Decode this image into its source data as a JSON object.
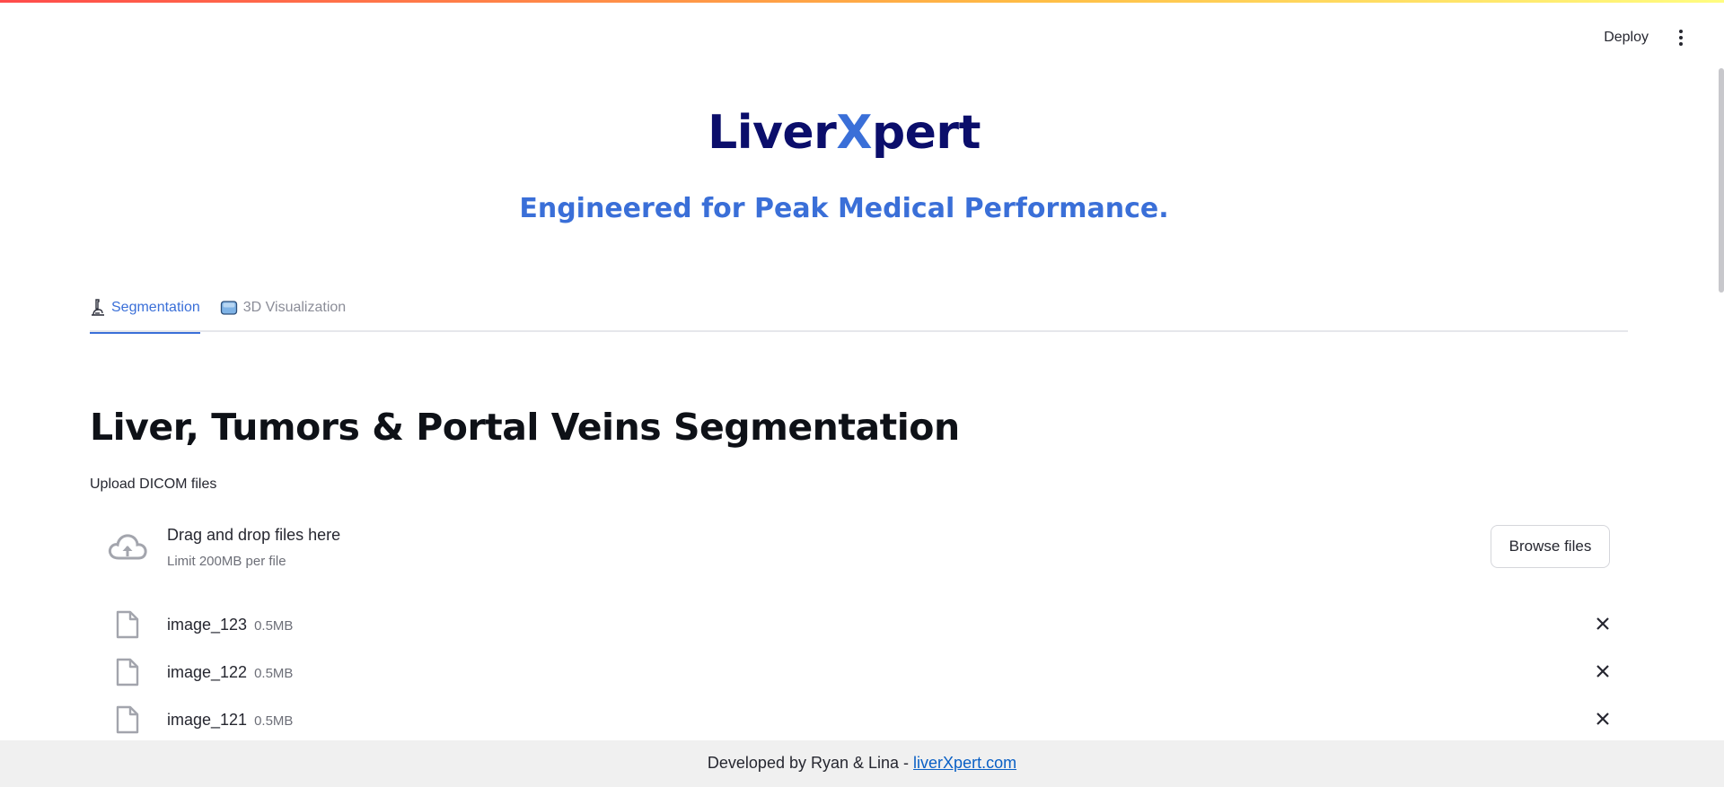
{
  "toolbar": {
    "deploy_label": "Deploy"
  },
  "hero": {
    "title_part1": "Liver",
    "title_part2": "X",
    "title_part3": "pert",
    "subtitle": "Engineered for Peak Medical Performance."
  },
  "tabs": [
    {
      "label": "Segmentation",
      "icon": "microscope-icon",
      "active": true
    },
    {
      "label": "3D Visualization",
      "icon": "cube-icon",
      "active": false
    }
  ],
  "main": {
    "section_title": "Liver, Tumors & Portal Veins Segmentation",
    "upload_label": "Upload DICOM files",
    "dropzone": {
      "main_text": "Drag and drop files here",
      "sub_text": "Limit 200MB per file",
      "browse_label": "Browse files"
    },
    "files": [
      {
        "name": "image_123",
        "size": "0.5MB"
      },
      {
        "name": "image_122",
        "size": "0.5MB"
      },
      {
        "name": "image_121",
        "size": "0.5MB"
      }
    ]
  },
  "footer": {
    "text": "Developed by Ryan & Lina - ",
    "link_text": "liverXpert.com"
  },
  "colors": {
    "accent": "#3a6fd8",
    "title_dark": "#0b0e6b"
  }
}
